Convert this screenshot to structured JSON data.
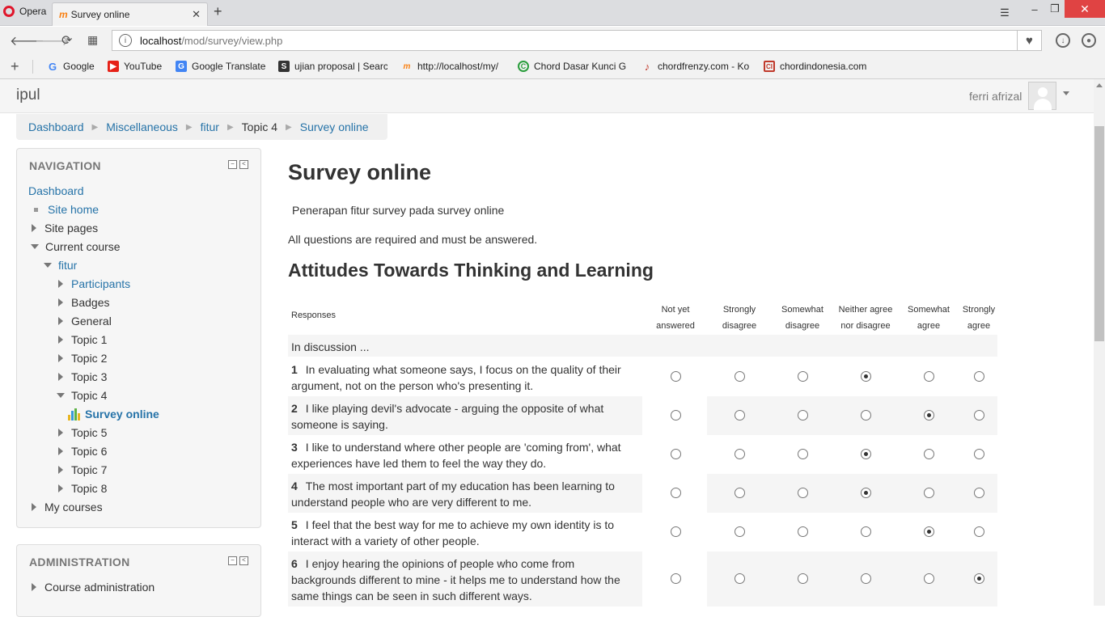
{
  "browser": {
    "opera_label": "Opera",
    "tab_title": "Survey online",
    "tab_close": "✕",
    "new_tab": "+",
    "url_host": "localhost",
    "url_path": "/mod/survey/view.php",
    "bookmarks": [
      {
        "label": "Google",
        "icon": "google-icon"
      },
      {
        "label": "YouTube",
        "icon": "youtube-icon"
      },
      {
        "label": "Google Translate",
        "icon": "translate-icon"
      },
      {
        "label": "ujian proposal | Searc",
        "icon": "scribd-icon"
      },
      {
        "label": "http://localhost/my/",
        "icon": "moodle-icon"
      },
      {
        "label": "Chord Dasar Kunci Gi",
        "icon": "chord-icon"
      },
      {
        "label": "chordfrenzy.com - Ko",
        "icon": "guitar-icon"
      },
      {
        "label": "chordindonesia.com",
        "icon": "chordindonesia-icon"
      }
    ]
  },
  "header": {
    "brand": "ipul",
    "user_name": "ferri afrizal"
  },
  "breadcrumb": [
    {
      "label": "Dashboard",
      "link": true
    },
    {
      "label": "Miscellaneous",
      "link": true
    },
    {
      "label": "fitur",
      "link": true
    },
    {
      "label": "Topic 4",
      "link": false
    },
    {
      "label": "Survey online",
      "link": true
    }
  ],
  "navigation": {
    "title": "NAVIGATION",
    "items": [
      {
        "label": "Dashboard"
      },
      {
        "label": "Site home"
      },
      {
        "label": "Site pages"
      },
      {
        "label": "Current course"
      },
      {
        "label": "fitur"
      },
      {
        "label": "Participants"
      },
      {
        "label": "Badges"
      },
      {
        "label": "General"
      },
      {
        "label": "Topic 1"
      },
      {
        "label": "Topic 2"
      },
      {
        "label": "Topic 3"
      },
      {
        "label": "Topic 4"
      },
      {
        "label": "Survey online"
      },
      {
        "label": "Topic 5"
      },
      {
        "label": "Topic 6"
      },
      {
        "label": "Topic 7"
      },
      {
        "label": "Topic 8"
      },
      {
        "label": "My courses"
      }
    ]
  },
  "administration": {
    "title": "ADMINISTRATION",
    "items": [
      {
        "label": "Course administration"
      }
    ]
  },
  "main": {
    "title": "Survey online",
    "intro": "Penerapan fitur survey pada survey online",
    "required_note": "All questions are required and must be answered.",
    "section_title": "Attitudes Towards Thinking and Learning",
    "responses_header": "Responses",
    "columns": [
      {
        "l1": "Not yet",
        "l2": "answered"
      },
      {
        "l1": "Strongly",
        "l2": "disagree"
      },
      {
        "l1": "Somewhat",
        "l2": "disagree"
      },
      {
        "l1": "Neither agree",
        "l2": "nor disagree"
      },
      {
        "l1": "Somewhat",
        "l2": "agree"
      },
      {
        "l1": "Strongly",
        "l2": "agree"
      }
    ],
    "group_label": "In discussion ...",
    "questions": [
      {
        "num": "1",
        "lines": [
          "In evaluating what someone says, I focus on the quality of their",
          "argument, not on the person who's presenting it."
        ],
        "selected": 3
      },
      {
        "num": "2",
        "lines": [
          "I like playing devil's advocate - arguing the opposite of what",
          "someone is saying."
        ],
        "selected": 4
      },
      {
        "num": "3",
        "lines": [
          "I like to understand where other people are 'coming from', what",
          "experiences have led them to feel the way they do."
        ],
        "selected": 3
      },
      {
        "num": "4",
        "lines": [
          "The most important part of my education has been learning to",
          "understand people who are very different to me."
        ],
        "selected": 3
      },
      {
        "num": "5",
        "lines": [
          "I feel that the best way for me to achieve my own identity is to",
          "interact with a variety of other people."
        ],
        "selected": 4
      },
      {
        "num": "6",
        "lines": [
          "I enjoy hearing the opinions of people who come from",
          "backgrounds different to mine - it helps me to understand how the",
          "same things can be seen in such different ways."
        ],
        "selected": 5
      }
    ]
  }
}
